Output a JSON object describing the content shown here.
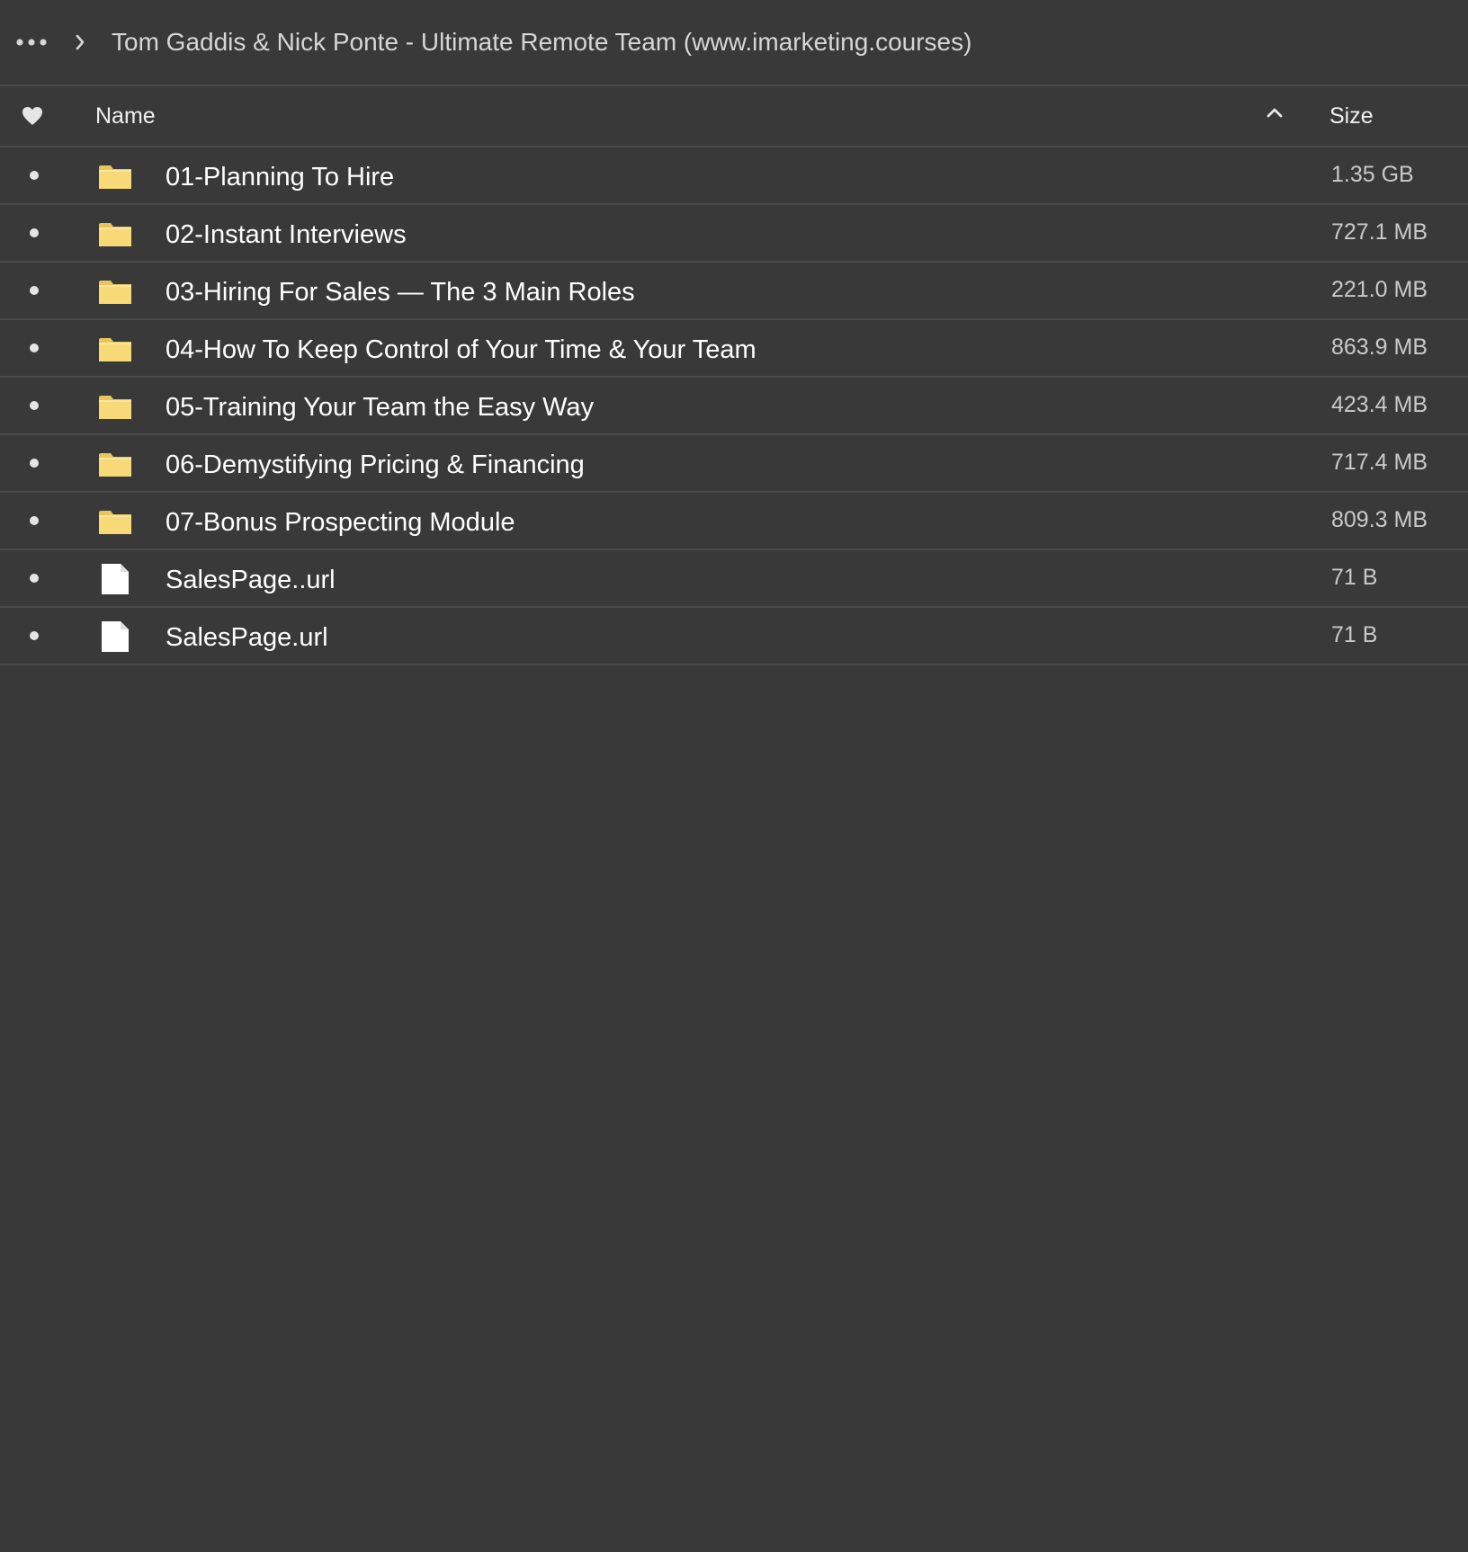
{
  "breadcrumb": {
    "more_icon": "ellipsis-icon",
    "separator_icon": "chevron-right-icon",
    "title": "Tom Gaddis & Nick Ponte - Ultimate Remote Team (www.imarketing.courses)"
  },
  "columns": {
    "favorite_icon": "heart-icon",
    "name_label": "Name",
    "sort_icon": "chevron-up-icon",
    "size_label": "Size"
  },
  "colors": {
    "background": "#393939",
    "divider": "#4a4a4a",
    "folder": "#f7d977",
    "file": "#ffffff"
  },
  "rows": [
    {
      "type": "folder",
      "name": "01-Planning To Hire",
      "size": "1.35 GB"
    },
    {
      "type": "folder",
      "name": "02-Instant Interviews",
      "size": "727.1 MB"
    },
    {
      "type": "folder",
      "name": "03-Hiring For Sales — The 3 Main Roles",
      "size": "221.0 MB"
    },
    {
      "type": "folder",
      "name": "04-How To Keep Control of Your Time & Your Team",
      "size": "863.9 MB"
    },
    {
      "type": "folder",
      "name": "05-Training Your Team the Easy Way",
      "size": "423.4 MB"
    },
    {
      "type": "folder",
      "name": "06-Demystifying Pricing & Financing",
      "size": "717.4 MB"
    },
    {
      "type": "folder",
      "name": "07-Bonus Prospecting Module",
      "size": "809.3 MB"
    },
    {
      "type": "file",
      "name": "SalesPage..url",
      "size": "71 B"
    },
    {
      "type": "file",
      "name": "SalesPage.url",
      "size": "71 B"
    }
  ]
}
